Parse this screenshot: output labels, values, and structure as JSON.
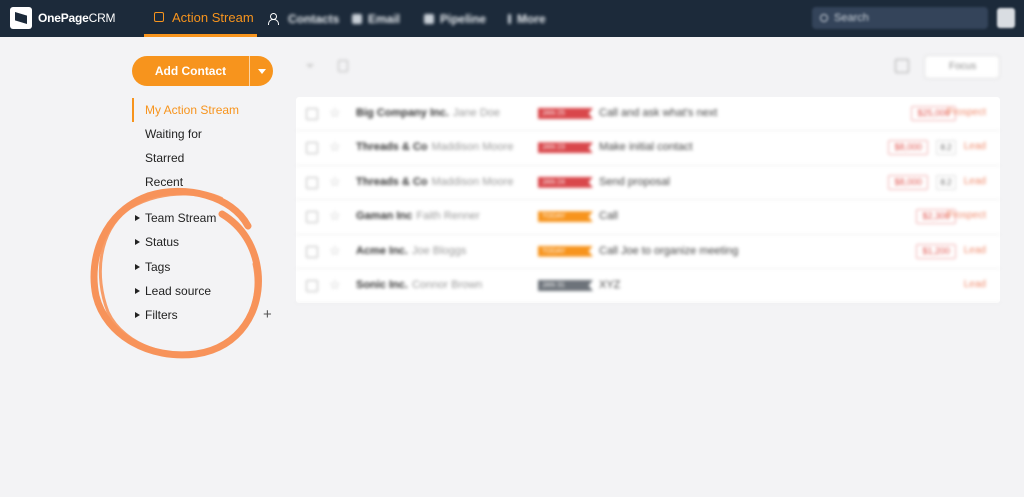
{
  "app": {
    "logo_text": "OnePage",
    "logo_text_suffix": "CRM"
  },
  "topnav": {
    "active_tab": "Action Stream",
    "tabs": [
      "Contacts",
      "Email",
      "Pipeline",
      "More"
    ],
    "search_placeholder": "Search"
  },
  "sidebar": {
    "add_contact_label": "Add Contact",
    "items": [
      {
        "label": "My Action Stream",
        "active": true
      },
      {
        "label": "Waiting for",
        "active": false
      },
      {
        "label": "Starred",
        "active": false
      },
      {
        "label": "Recent",
        "active": false
      }
    ],
    "groups": [
      "Team Stream",
      "Status",
      "Tags",
      "Lead source",
      "Filters"
    ],
    "add_filter_symbol": "+"
  },
  "toolbar": {
    "focus_label": "Focus"
  },
  "rows": [
    {
      "company": "Big Company Inc.",
      "person": "Jane Doe",
      "tag": "JAN 25",
      "tag_color": "#d9474b",
      "action": "Call and ask what's next",
      "amount": "$25,000",
      "mini": "",
      "status": "Prospect"
    },
    {
      "company": "Threads & Co",
      "person": "Maddison Moore",
      "tag": "JAN 23",
      "tag_color": "#d9474b",
      "action": "Make initial contact",
      "amount": "$8,000",
      "mini": "8.2",
      "status": "Lead"
    },
    {
      "company": "Threads & Co",
      "person": "Maddison Moore",
      "tag": "JAN 24",
      "tag_color": "#d9474b",
      "action": "Send proposal",
      "amount": "$8,000",
      "mini": "8.2",
      "status": "Lead"
    },
    {
      "company": "Gaman Inc",
      "person": "Faith Renner",
      "tag": "TODAY",
      "tag_color": "#f7941d",
      "action": "Call",
      "amount": "$2,300",
      "mini": "",
      "status": "Prospect"
    },
    {
      "company": "Acme Inc.",
      "person": "Joe Bloggs",
      "tag": "TODAY",
      "tag_color": "#f7941d",
      "action": "Call Joe to organize meeting",
      "amount": "$1,200",
      "mini": "",
      "status": "Lead"
    },
    {
      "company": "Sonic Inc.",
      "person": "Connor Brown",
      "tag": "JAN 31",
      "tag_color": "#6d737a",
      "action": "XYZ",
      "amount": "",
      "mini": "",
      "status": "Lead"
    }
  ],
  "colors": {
    "accent": "#f7941d",
    "nav_bg": "#1c2a3a",
    "scribble": "#f7935a"
  }
}
